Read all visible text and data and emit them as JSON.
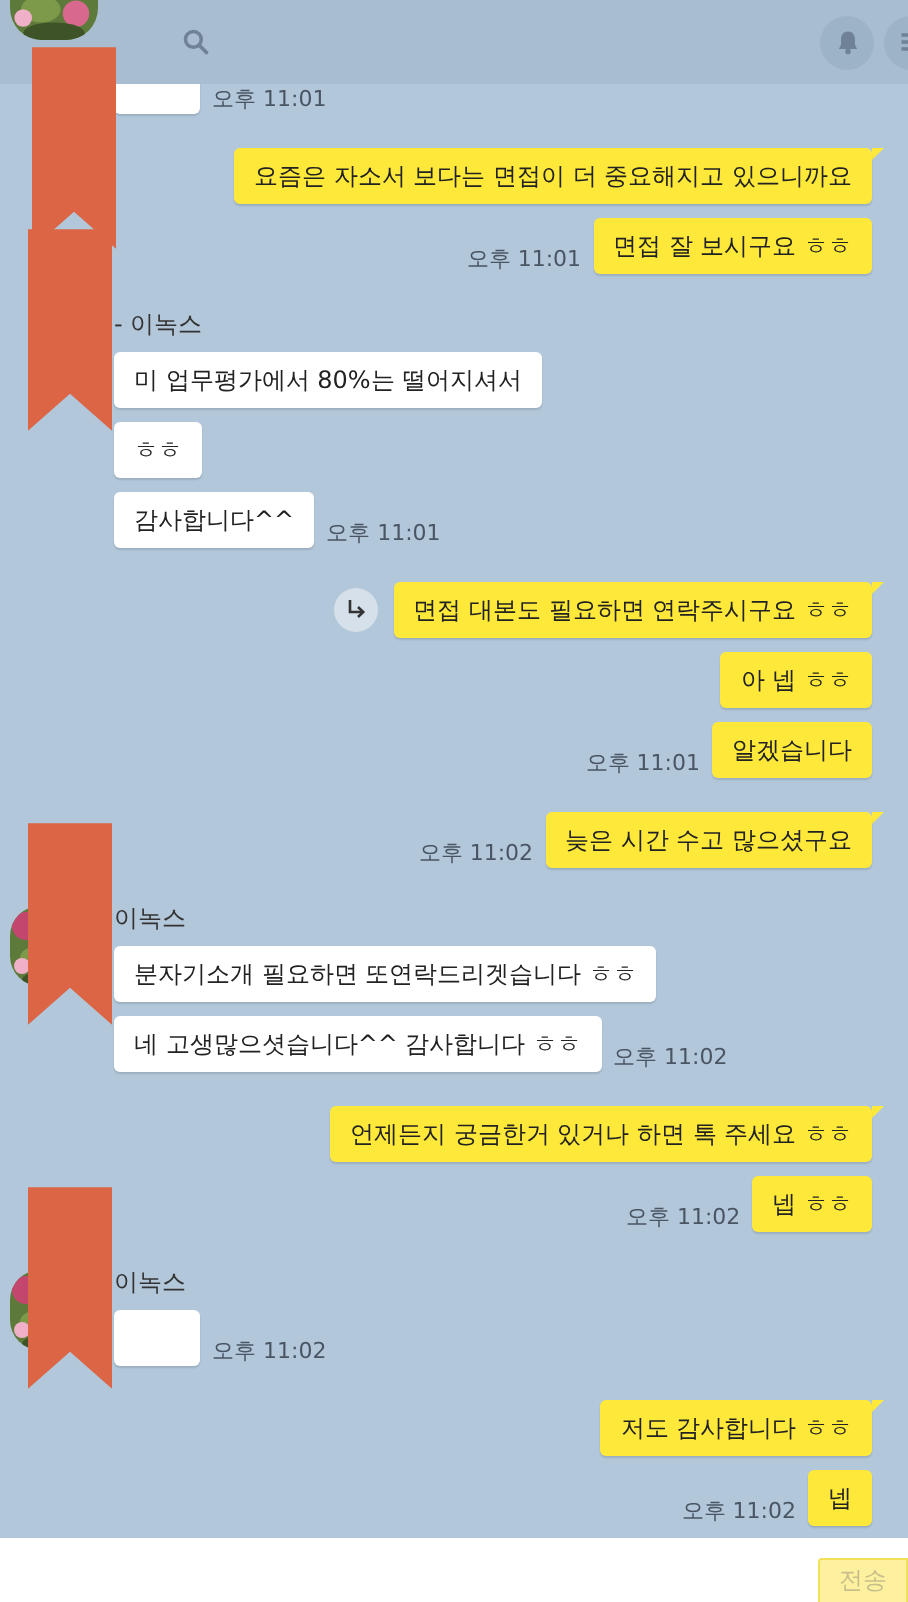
{
  "header": {
    "avatar": true,
    "redacted": true
  },
  "groups": [
    {
      "kind": "incoming",
      "messages": [
        {
          "time": "오후 11:01"
        }
      ]
    },
    {
      "kind": "outgoing",
      "messages": [
        {
          "text": "요즘은 자소서 보다는 면접이 더 중요해지고 있으니까요",
          "tail": true
        },
        {
          "text": "면접 잘 보시구요 ㅎㅎ",
          "time": "오후 11:01"
        }
      ]
    },
    {
      "kind": "incoming",
      "name": "- 이녹스",
      "redacted": true,
      "messages": [
        {
          "text": "미 업무평가에서 80%는 떨어지셔서"
        },
        {
          "text": "ㅎㅎ"
        },
        {
          "text": "감사합니다^^",
          "time": "오후 11:01"
        }
      ]
    },
    {
      "kind": "outgoing",
      "messages": [
        {
          "text": "면접 대본도 필요하면 연락주시구요 ㅎㅎ",
          "tail": true,
          "reply": true
        },
        {
          "text": "아 넵 ㅎㅎ"
        },
        {
          "text": "알겠습니다",
          "time": "오후 11:01"
        }
      ]
    },
    {
      "kind": "outgoing",
      "messages": [
        {
          "text": "늦은 시간 수고 많으셨구요",
          "tail": true,
          "time": "오후 11:02"
        }
      ]
    },
    {
      "kind": "incoming",
      "name": "이녹스",
      "avatar": true,
      "redacted": true,
      "messages": [
        {
          "text": "분자기소개 필요하면 또연락드리겟습니다 ㅎㅎ"
        },
        {
          "text": "네 고생많으셧습니다^^ 감사합니다 ㅎㅎ",
          "time": "오후 11:02"
        }
      ]
    },
    {
      "kind": "outgoing",
      "messages": [
        {
          "text": "언제든지 궁금한거 있거나 하면 톡 주세요 ㅎㅎ",
          "tail": true
        },
        {
          "text": "넵 ㅎㅎ",
          "time": "오후 11:02"
        }
      ]
    },
    {
      "kind": "incoming",
      "name": "이녹스",
      "avatar": true,
      "redacted": true,
      "messages": [
        {
          "time": "오후 11:02"
        }
      ]
    },
    {
      "kind": "outgoing",
      "messages": [
        {
          "text": "저도 감사합니다 ㅎㅎ",
          "tail": true
        },
        {
          "text": "넵",
          "time": "오후 11:02"
        }
      ]
    }
  ],
  "send_button": {
    "label": "전송",
    "disabled": true
  }
}
